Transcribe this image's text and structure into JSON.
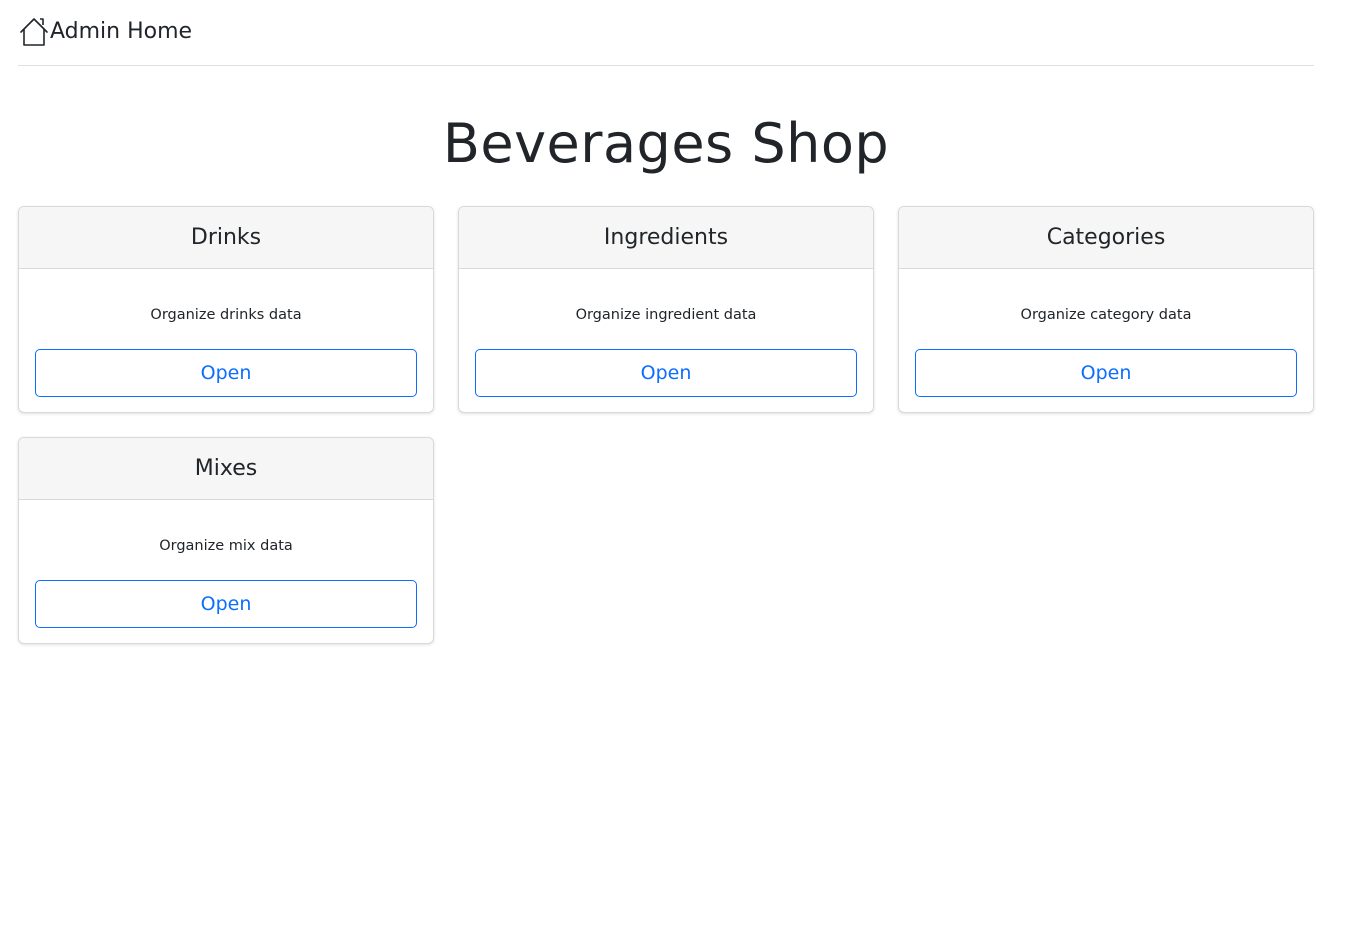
{
  "nav": {
    "home_label": "Admin Home",
    "home_icon": "house-icon"
  },
  "page": {
    "title": "Beverages Shop"
  },
  "cards": [
    {
      "title": "Drinks",
      "description": "Organize drinks data",
      "button_label": "Open"
    },
    {
      "title": "Ingredients",
      "description": "Organize ingredient data",
      "button_label": "Open"
    },
    {
      "title": "Categories",
      "description": "Organize category data",
      "button_label": "Open"
    },
    {
      "title": "Mixes",
      "description": "Organize mix data",
      "button_label": "Open"
    }
  ],
  "colors": {
    "accent": "#0d6efd",
    "card_header_bg": "#f6f6f6",
    "border": "#d7d9dc",
    "text": "#212529"
  }
}
